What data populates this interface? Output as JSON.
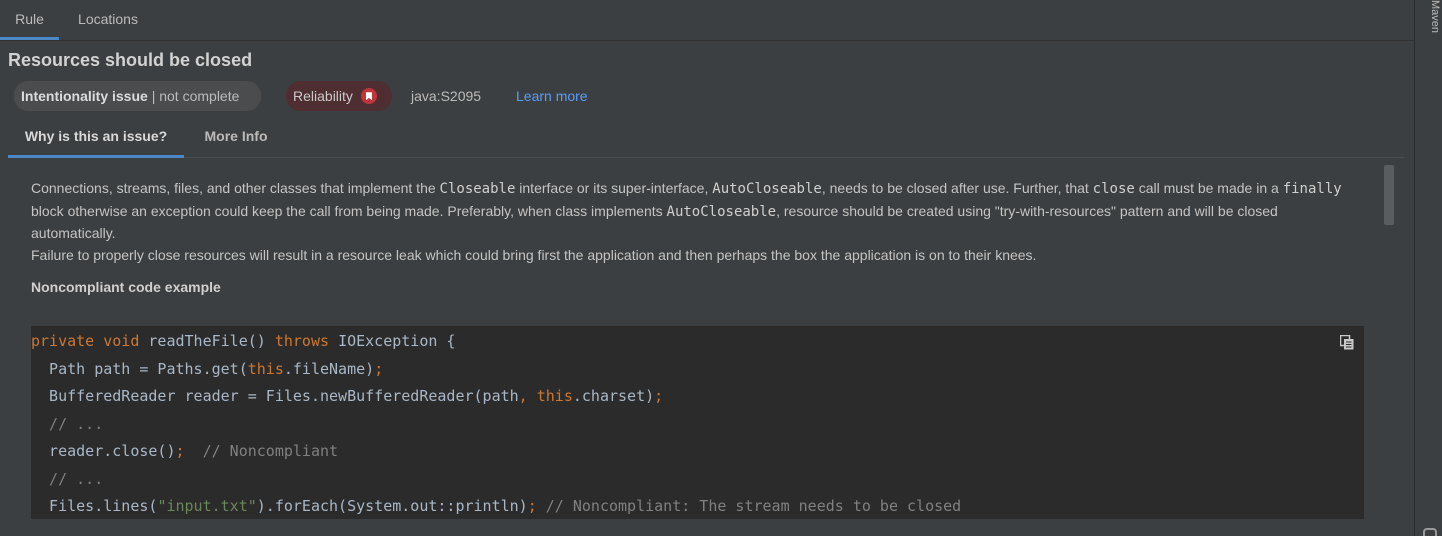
{
  "top_tabs": [
    {
      "label": "Rule",
      "active": true
    },
    {
      "label": "Locations",
      "active": false
    }
  ],
  "side_strip": {
    "label": "Maven"
  },
  "rule": {
    "title": "Resources should be closed",
    "clean_code": {
      "attribute": "Intentionality issue",
      "separator": " | ",
      "detail": "not complete"
    },
    "quality": {
      "label": "Reliability",
      "severity_icon": "severity-high-icon",
      "severity_color": "#c0353d"
    },
    "key": "java:S2095",
    "learn_more": "Learn more"
  },
  "sub_tabs": [
    {
      "label": "Why is this an issue?",
      "active": true
    },
    {
      "label": "More Info",
      "active": false
    }
  ],
  "description": {
    "p1": [
      {
        "t": "Connections, streams, files, and other classes that implement the "
      },
      {
        "c": "Closeable"
      },
      {
        "t": " interface or its super-interface, "
      },
      {
        "c": "AutoCloseable"
      },
      {
        "t": ", needs to be closed after use. Further, that "
      },
      {
        "c": "close"
      },
      {
        "t": " call must be made in a "
      },
      {
        "c": "finally"
      },
      {
        "t": " block otherwise an exception could keep the call from being made. Preferably, when class implements "
      },
      {
        "c": "AutoCloseable"
      },
      {
        "t": ", resource should be created using \"try-with-resources\" pattern and will be closed automatically."
      }
    ],
    "p2": "Failure to properly close resources will result in a resource leak which could bring first the application and then perhaps the box the application is on to their knees.",
    "section_title": "Noncompliant code example"
  },
  "code_lines": [
    [
      [
        "kw",
        "private "
      ],
      [
        "kw",
        "void "
      ],
      [
        "",
        "readTheFile() "
      ],
      [
        "kw",
        "throws "
      ],
      [
        "",
        "IOException {"
      ]
    ],
    [
      [
        "",
        "  Path path = Paths.get("
      ],
      [
        "kw",
        "this"
      ],
      [
        "",
        ".fileName)"
      ],
      [
        "kw",
        ";"
      ]
    ],
    [
      [
        "",
        "  BufferedReader reader = Files.newBufferedReader(path"
      ],
      [
        "kw",
        ", "
      ],
      [
        "kw",
        "this"
      ],
      [
        "",
        ".charset)"
      ],
      [
        "kw",
        ";"
      ]
    ],
    [
      [
        "cm",
        "  // ..."
      ]
    ],
    [
      [
        "",
        "  reader.close()"
      ],
      [
        "kw",
        ";"
      ],
      [
        "cm",
        "  // Noncompliant"
      ]
    ],
    [
      [
        "cm",
        "  // ..."
      ]
    ],
    [
      [
        "",
        "  Files.lines("
      ],
      [
        "str",
        "\"input.txt\""
      ],
      [
        "",
        ").forEach(System.out::println)"
      ],
      [
        "kw",
        "; "
      ],
      [
        "cm",
        "// Noncompliant: The stream needs to be closed"
      ]
    ]
  ],
  "colors": {
    "accent": "#4a88c7",
    "link": "#589df6",
    "keyword": "#cc7832",
    "comment": "#808080",
    "string": "#6a8759"
  }
}
